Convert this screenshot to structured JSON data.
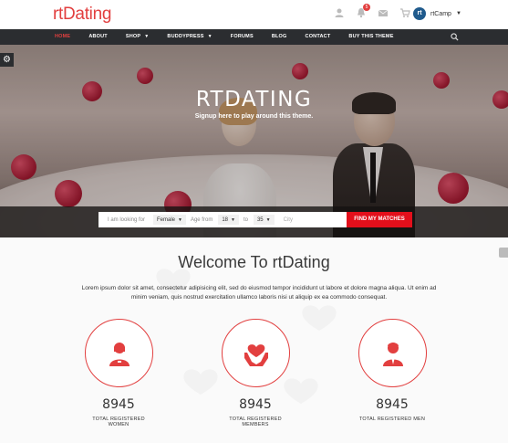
{
  "header": {
    "logo": "rtDating",
    "icons": [
      "user-icon",
      "bell-icon",
      "mail-icon",
      "cart-icon"
    ],
    "notification_count": "5",
    "user_avatar_initials": "rt",
    "user_name": "rtCamp"
  },
  "nav": {
    "items": [
      {
        "label": "HOME",
        "active": true
      },
      {
        "label": "ABOUT"
      },
      {
        "label": "SHOP",
        "dropdown": true
      },
      {
        "label": "BUDDYPRESS",
        "dropdown": true
      },
      {
        "label": "FORUMS"
      },
      {
        "label": "BLOG"
      },
      {
        "label": "CONTACT"
      },
      {
        "label": "BUY THIS THEME"
      }
    ]
  },
  "hero": {
    "title": "RTDATING",
    "subtitle": "Signup here to play around this theme."
  },
  "search": {
    "looking_for_label": "I am looking for",
    "gender_value": "Female",
    "age_from_label": "Age from",
    "age_from_value": "18",
    "to_label": "to",
    "age_to_value": "35",
    "city_placeholder": "City",
    "button_label": "FIND MY MATCHES"
  },
  "welcome": {
    "title": "Welcome To rtDating",
    "text": "Lorem ipsum dolor sit amet, consectetur adipisicing elit, sed do eiusmod tempor incididunt ut labore et dolore magna aliqua. Ut enim ad minim veniam, quis nostrud exercitation ullamco laboris nisi ut aliquip ex ea commodo consequat."
  },
  "stats": [
    {
      "value": "8945",
      "label": "TOTAL REGISTERED WOMEN",
      "icon": "woman-icon"
    },
    {
      "value": "8945",
      "label": "TOTAL REGISTERED MEMBERS",
      "icon": "heart-hands-icon"
    },
    {
      "value": "8945",
      "label": "TOTAL REGISTERED MEN",
      "icon": "man-icon"
    }
  ],
  "colors": {
    "accent": "#e23f3f",
    "nav_bg": "#2b2d30",
    "button": "#e30f1b"
  }
}
